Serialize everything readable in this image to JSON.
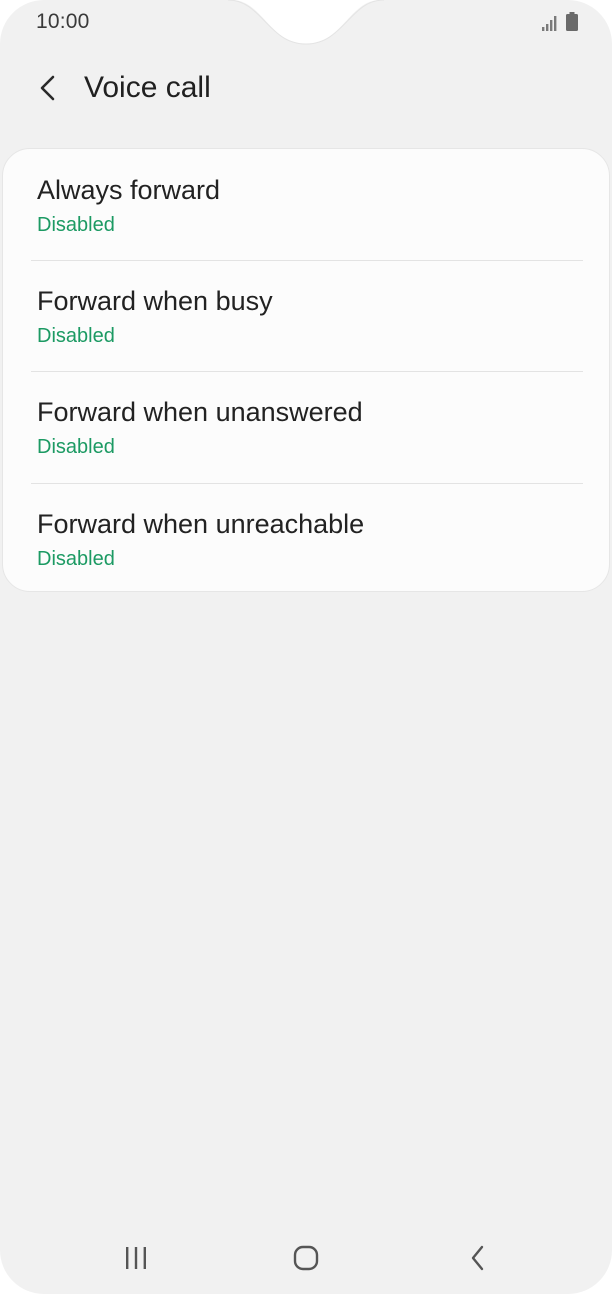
{
  "status_bar": {
    "time": "10:00",
    "signal_icon": "signal-icon",
    "battery_icon": "battery-icon"
  },
  "header": {
    "back_icon": "back-arrow-icon",
    "title": "Voice call"
  },
  "items": [
    {
      "title": "Always forward",
      "status": "Disabled"
    },
    {
      "title": "Forward when busy",
      "status": "Disabled"
    },
    {
      "title": "Forward when unanswered",
      "status": "Disabled"
    },
    {
      "title": "Forward when unreachable",
      "status": "Disabled"
    }
  ],
  "nav_bar": {
    "recents_icon": "recents-icon",
    "home_icon": "home-icon",
    "back_icon": "nav-back-icon"
  },
  "colors": {
    "background": "#f1f1f1",
    "card": "#fcfcfc",
    "status_green": "#1c9a63",
    "text": "#222222"
  }
}
